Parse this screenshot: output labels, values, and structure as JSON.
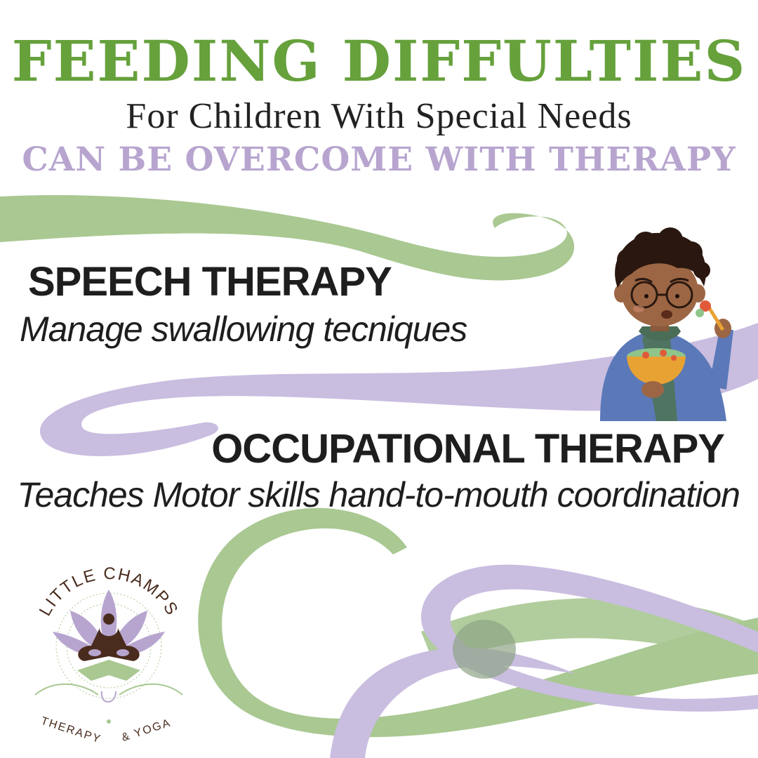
{
  "colors": {
    "green": "#66a13c",
    "green_light": "#a9c892",
    "lavender": "#b7a5cf",
    "lavender_light": "#c9bde0",
    "dark_text": "#1e1e1e",
    "brown": "#4a2c1e"
  },
  "header": {
    "title": "FEEDING DIFFULTIES",
    "subtitle": "For Children With Special Needs",
    "tagline": "CAN BE OVERCOME WITH THERAPY"
  },
  "sections": [
    {
      "heading": "SPEECH THERAPY",
      "description": "Manage swallowing tecniques"
    },
    {
      "heading": "OCCUPATIONAL THERAPY",
      "description": "Teaches Motor skills hand-to-mouth coordination"
    }
  ],
  "illustration": {
    "icon": "child-eating-icon"
  },
  "logo": {
    "icon": "lotus-meditation-icon",
    "top_text": "LITTLE CHAMPS",
    "bottom_left": "THERAPY",
    "bottom_right": "& YOGA"
  }
}
